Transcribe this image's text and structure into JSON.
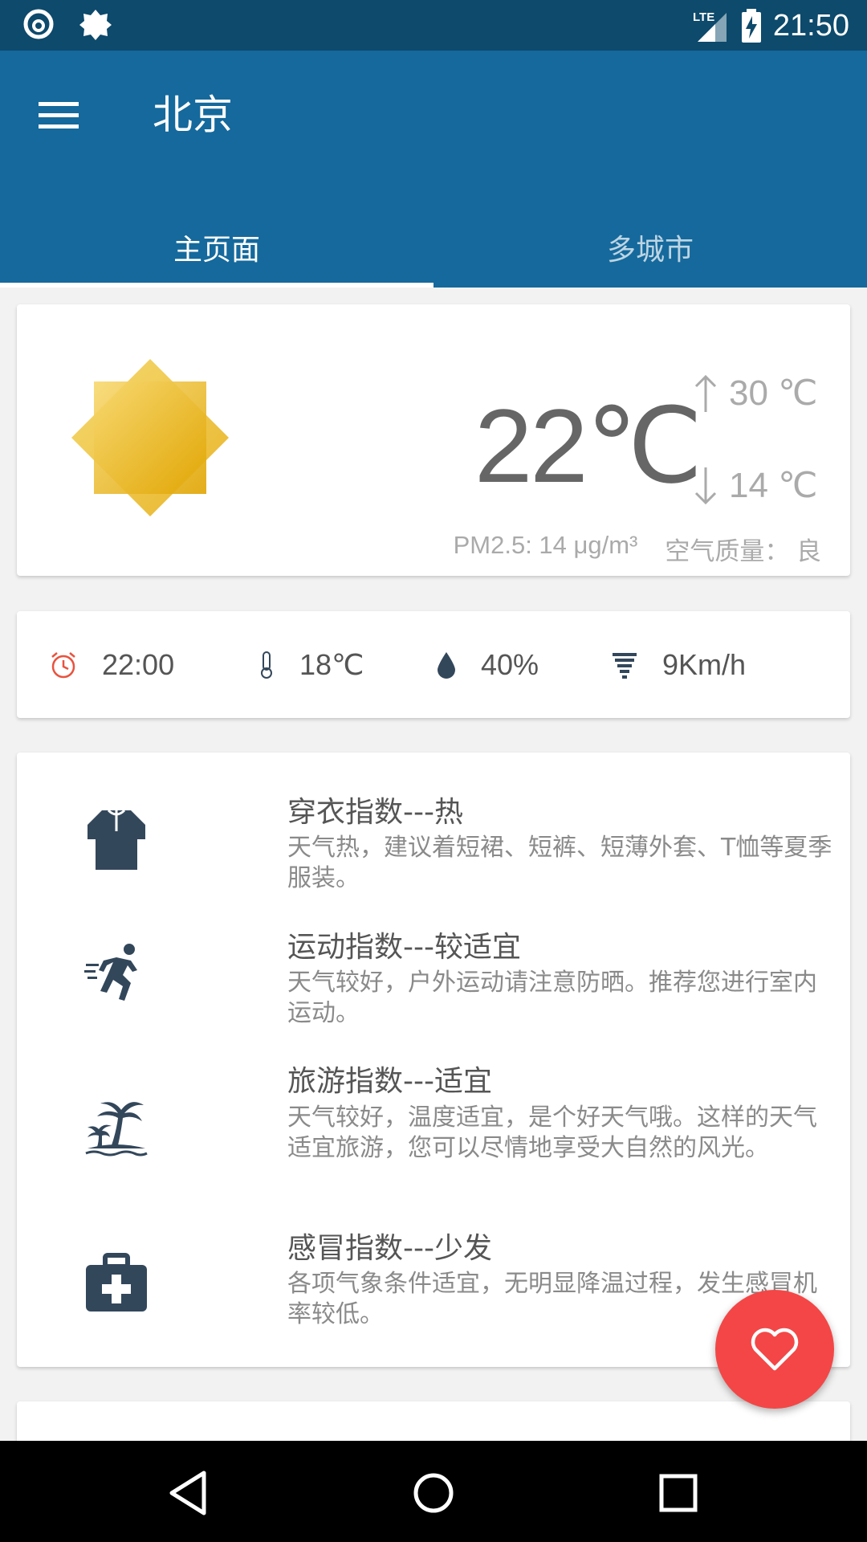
{
  "status_bar": {
    "time": "21:50",
    "network": "LTE",
    "left_icons": [
      "netease-music-icon",
      "settings-gear-icon"
    ]
  },
  "app_bar": {
    "city": "北京",
    "tabs": [
      {
        "label": "主页面",
        "active": true
      },
      {
        "label": "多城市",
        "active": false
      }
    ]
  },
  "current": {
    "condition_icon": "sunny-icon",
    "temperature": "22℃",
    "high": "30 ℃",
    "low": "14 ℃",
    "pm25": "PM2.5: 14 μg/m³",
    "air_quality": "空气质量：  良"
  },
  "details": {
    "time": "22:00",
    "temperature": "18℃",
    "humidity": "40%",
    "wind": "9Km/h"
  },
  "indices": [
    {
      "icon": "shirt-icon",
      "title": "穿衣指数---热",
      "desc": "天气热，建议着短裙、短裤、短薄外套、T恤等夏季服装。"
    },
    {
      "icon": "running-icon",
      "title": "运动指数---较适宜",
      "desc": "天气较好，户外运动请注意防晒。推荐您进行室内运动。"
    },
    {
      "icon": "palm-tree-icon",
      "title": "旅游指数---适宜",
      "desc": "天气较好，温度适宜，是个好天气哦。这样的天气适宜旅游，您可以尽情地享受大自然的风光。"
    },
    {
      "icon": "medical-kit-icon",
      "title": "感冒指数---少发",
      "desc": "各项气象条件适宜，无明显降温过程，发生感冒机率较低。"
    }
  ],
  "colors": {
    "primary": "#15699c",
    "primary_dark": "#0d4a6c",
    "fab": "#f44646",
    "sun": "#f0c020"
  }
}
